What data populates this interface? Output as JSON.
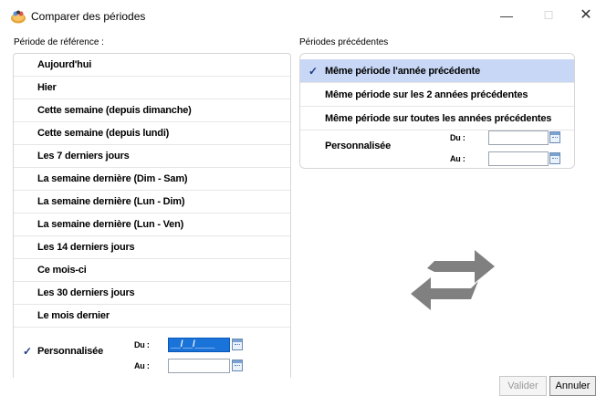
{
  "window": {
    "title": "Comparer des périodes",
    "minimize": "—",
    "maximize": "☐",
    "close": "✕"
  },
  "left": {
    "label": "Période de référence :",
    "items": [
      "Aujourd'hui",
      "Hier",
      "Cette semaine (depuis dimanche)",
      "Cette semaine (depuis lundi)",
      "Les 7 derniers jours",
      "La semaine dernière (Dim - Sam)",
      "La semaine dernière (Lun - Dim)",
      "La semaine dernière (Lun - Ven)",
      "Les 14 derniers jours",
      "Ce mois-ci",
      "Les 30 derniers jours",
      "Le mois dernier"
    ],
    "custom": {
      "label": "Personnalisée",
      "checkmark": "✓",
      "du_label": "Du :",
      "au_label": "Au :",
      "du_value": "__/__/____",
      "au_value": ""
    }
  },
  "right": {
    "label": "Périodes précédentes",
    "checkmark": "✓",
    "items": [
      "Même période l'année précédente",
      "Même période sur les 2 années précédentes",
      "Même période sur toutes les années précédentes"
    ],
    "custom": {
      "label": "Personnalisée",
      "du_label": "Du :",
      "au_label": "Au :",
      "du_value": "",
      "au_value": ""
    }
  },
  "buttons": {
    "valider": "Valider",
    "annuler": "Annuler"
  },
  "icons": {
    "app": "app-logo-icon",
    "swap": "swap-arrows-icon",
    "calendar": "calendar-icon"
  }
}
